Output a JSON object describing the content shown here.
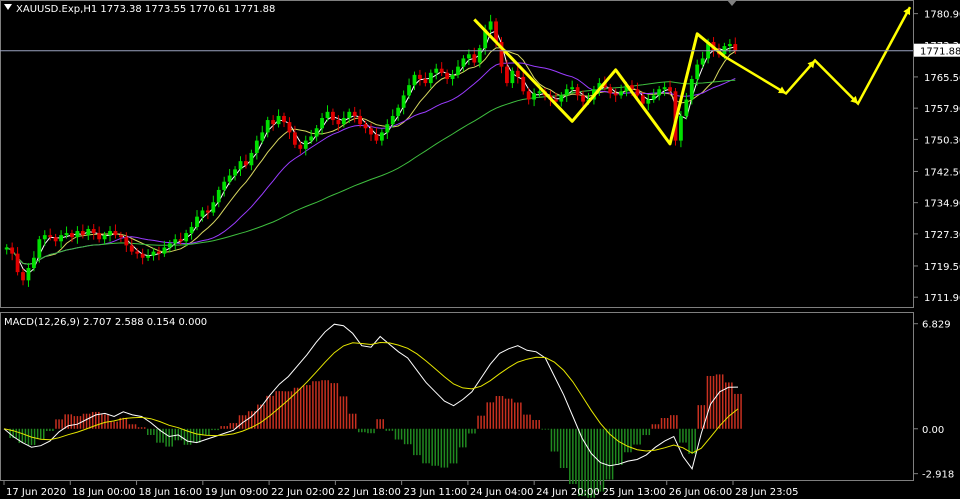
{
  "chart_data": {
    "type": "candlestick",
    "symbol_header": "XAUUSD.Exp,H1  1773.38 1773.55 1770.61 1771.88",
    "current_price_label": "1771.88",
    "current_price": 1771.88,
    "price_axis": {
      "ticks": [
        "1780.90",
        "1773.30",
        "1765.50",
        "1757.90",
        "1750.30",
        "1742.50",
        "1734.90",
        "1727.30",
        "1719.50",
        "1711.90"
      ],
      "range": [
        1710.0,
        1783.0
      ]
    },
    "time_axis": {
      "ticks": [
        "17 Jun 2020",
        "18 Jun 00:00",
        "18 Jun 16:00",
        "19 Jun 09:00",
        "22 Jun 02:00",
        "22 Jun 18:00",
        "23 Jun 11:00",
        "24 Jun 04:00",
        "24 Jun 20:00",
        "25 Jun 13:00",
        "26 Jun 06:00",
        "28 Jun 23:05"
      ]
    },
    "candle_closes": [
      1724.0,
      1722.5,
      1718.0,
      1716.0,
      1719.0,
      1721.5,
      1726.0,
      1727.0,
      1726.5,
      1725.5,
      1727.0,
      1727.5,
      1726.5,
      1728.0,
      1727.0,
      1728.5,
      1727.5,
      1726.0,
      1727.0,
      1728.0,
      1727.0,
      1726.5,
      1724.5,
      1723.0,
      1722.5,
      1721.5,
      1722.0,
      1723.0,
      1722.5,
      1724.0,
      1725.0,
      1726.0,
      1725.5,
      1727.5,
      1729.0,
      1731.5,
      1733.0,
      1732.5,
      1735.0,
      1738.0,
      1740.0,
      1741.5,
      1743.0,
      1745.0,
      1744.0,
      1747.0,
      1750.0,
      1752.0,
      1755.0,
      1754.0,
      1756.0,
      1754.5,
      1752.0,
      1749.0,
      1748.0,
      1750.0,
      1751.0,
      1753.0,
      1755.5,
      1757.0,
      1755.0,
      1754.0,
      1755.5,
      1757.0,
      1756.0,
      1754.0,
      1753.0,
      1751.5,
      1750.0,
      1752.0,
      1754.0,
      1756.0,
      1758.0,
      1761.0,
      1763.5,
      1766.0,
      1765.0,
      1764.0,
      1766.5,
      1767.5,
      1766.5,
      1765.0,
      1766.0,
      1768.0,
      1770.0,
      1771.0,
      1769.0,
      1772.5,
      1777.0,
      1779.0,
      1774.0,
      1768.0,
      1764.0,
      1767.0,
      1765.5,
      1762.0,
      1760.0,
      1761.5,
      1762.0,
      1761.0,
      1760.0,
      1759.5,
      1761.0,
      1762.5,
      1763.0,
      1761.0,
      1759.5,
      1760.0,
      1762.5,
      1764.0,
      1763.0,
      1761.5,
      1761.0,
      1762.0,
      1763.5,
      1762.5,
      1761.0,
      1759.0,
      1760.0,
      1761.0,
      1762.5,
      1763.0,
      1762.0,
      1750.0,
      1756.0,
      1760.0,
      1765.0,
      1768.5,
      1770.0,
      1774.0,
      1772.0,
      1771.0,
      1773.0,
      1773.5,
      1771.88
    ],
    "moving_averages": [
      {
        "color": "#ffffff",
        "period_candles": 3
      },
      {
        "color": "#d8d860",
        "period_candles": 8
      },
      {
        "color": "#9a3cff",
        "period_candles": 18
      },
      {
        "color": "#3fbf3f",
        "period_candles": 50
      }
    ],
    "annotations": {
      "zigzag_color": "#ffff00",
      "zigzag_prices": [
        1779.5,
        1754.7,
        1767.2,
        1749.2,
        1776.0,
        1770.5
      ],
      "forecast_prices": [
        1770.5,
        1761.5,
        1769.5,
        1759.0,
        1782.5
      ]
    },
    "macd": {
      "label": "MACD(12,26,9) 2.707 2.588 0.154 0.000",
      "ticks": [
        "6.829",
        "0.00",
        "-2.918"
      ],
      "range": [
        -3.2,
        7.2
      ],
      "values": [
        0.0,
        -0.5,
        -0.9,
        -1.2,
        -1.1,
        -0.8,
        -0.2,
        0.2,
        0.3,
        0.6,
        0.9,
        1.0,
        0.8,
        1.1,
        0.9,
        0.8,
        0.4,
        -0.1,
        -0.5,
        -0.4,
        -0.8,
        -0.9,
        -0.7,
        -0.5,
        -0.3,
        -0.1,
        0.4,
        0.8,
        1.4,
        2.2,
        2.9,
        3.4,
        4.1,
        4.8,
        5.6,
        6.3,
        6.8,
        6.7,
        6.2,
        5.4,
        5.3,
        6.0,
        5.5,
        5.0,
        4.6,
        3.8,
        3.0,
        2.4,
        1.8,
        1.5,
        1.9,
        2.4,
        3.3,
        4.2,
        4.9,
        5.2,
        5.4,
        5.1,
        5.0,
        4.6,
        3.4,
        2.2,
        0.8,
        -0.6,
        -1.6,
        -2.2,
        -2.4,
        -2.3,
        -2.1,
        -2.0,
        -1.7,
        -1.2,
        -0.8,
        -0.5,
        -1.8,
        -2.6,
        -0.3,
        1.6,
        2.4,
        2.7,
        2.707
      ]
    }
  }
}
